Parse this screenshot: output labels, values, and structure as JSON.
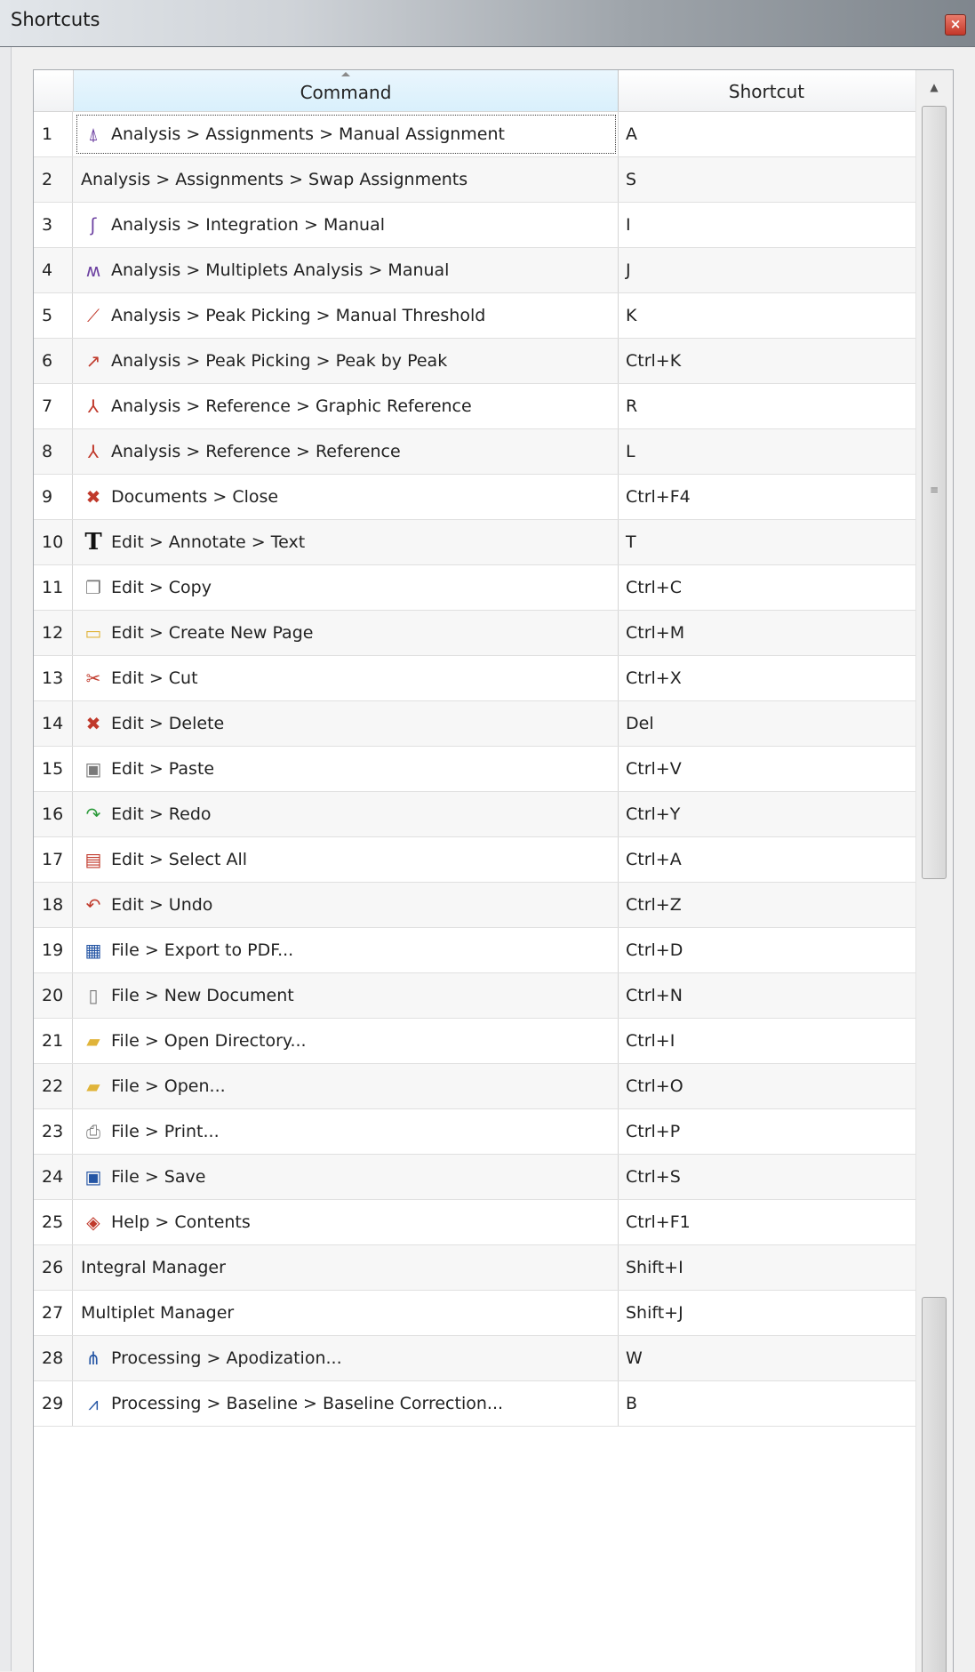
{
  "window": {
    "title": "Shortcuts",
    "close_icon": "close-icon"
  },
  "table": {
    "headers": {
      "command": "Command",
      "shortcut": "Shortcut"
    },
    "rows": [
      {
        "num": "1",
        "command": "Analysis > Assignments > Manual Assignment",
        "shortcut": "A",
        "icon": "manual-assignment-icon",
        "glyph": "⍋"
      },
      {
        "num": "2",
        "command": "Analysis > Assignments > Swap Assignments",
        "shortcut": "S",
        "icon": "",
        "glyph": ""
      },
      {
        "num": "3",
        "command": "Analysis > Integration > Manual",
        "shortcut": "I",
        "icon": "integration-icon",
        "glyph": "ʃ"
      },
      {
        "num": "4",
        "command": "Analysis > Multiplets Analysis > Manual",
        "shortcut": "J",
        "icon": "multiplets-icon",
        "glyph": "ʍ"
      },
      {
        "num": "5",
        "command": "Analysis > Peak Picking > Manual Threshold",
        "shortcut": "K",
        "icon": "peak-threshold-icon",
        "glyph": "⟋"
      },
      {
        "num": "6",
        "command": "Analysis > Peak Picking > Peak by Peak",
        "shortcut": "Ctrl+K",
        "icon": "peak-by-peak-icon",
        "glyph": "↗"
      },
      {
        "num": "7",
        "command": "Analysis > Reference > Graphic Reference",
        "shortcut": "R",
        "icon": "graphic-reference-icon",
        "glyph": "⅄"
      },
      {
        "num": "8",
        "command": "Analysis > Reference > Reference",
        "shortcut": "L",
        "icon": "reference-icon",
        "glyph": "⅄"
      },
      {
        "num": "9",
        "command": "Documents > Close",
        "shortcut": "Ctrl+F4",
        "icon": "document-close-icon",
        "glyph": "✖"
      },
      {
        "num": "10",
        "command": "Edit > Annotate > Text",
        "shortcut": "T",
        "icon": "text-icon",
        "glyph": "T"
      },
      {
        "num": "11",
        "command": "Edit > Copy",
        "shortcut": "Ctrl+C",
        "icon": "copy-icon",
        "glyph": "❐"
      },
      {
        "num": "12",
        "command": "Edit > Create New Page",
        "shortcut": "Ctrl+M",
        "icon": "new-page-icon",
        "glyph": "▭"
      },
      {
        "num": "13",
        "command": "Edit > Cut",
        "shortcut": "Ctrl+X",
        "icon": "cut-icon",
        "glyph": "✂"
      },
      {
        "num": "14",
        "command": "Edit > Delete",
        "shortcut": "Del",
        "icon": "delete-icon",
        "glyph": "✖"
      },
      {
        "num": "15",
        "command": "Edit > Paste",
        "shortcut": "Ctrl+V",
        "icon": "paste-icon",
        "glyph": "▣"
      },
      {
        "num": "16",
        "command": "Edit > Redo",
        "shortcut": "Ctrl+Y",
        "icon": "redo-icon",
        "glyph": "↷"
      },
      {
        "num": "17",
        "command": "Edit > Select All",
        "shortcut": "Ctrl+A",
        "icon": "select-all-icon",
        "glyph": "▤"
      },
      {
        "num": "18",
        "command": "Edit > Undo",
        "shortcut": "Ctrl+Z",
        "icon": "undo-icon",
        "glyph": "↶"
      },
      {
        "num": "19",
        "command": "File > Export to PDF...",
        "shortcut": "Ctrl+D",
        "icon": "export-pdf-icon",
        "glyph": "▦"
      },
      {
        "num": "20",
        "command": "File > New Document",
        "shortcut": "Ctrl+N",
        "icon": "new-document-icon",
        "glyph": "▯"
      },
      {
        "num": "21",
        "command": "File > Open Directory...",
        "shortcut": "Ctrl+I",
        "icon": "open-directory-icon",
        "glyph": "▰"
      },
      {
        "num": "22",
        "command": "File > Open...",
        "shortcut": "Ctrl+O",
        "icon": "open-folder-icon",
        "glyph": "▰"
      },
      {
        "num": "23",
        "command": "File > Print...",
        "shortcut": "Ctrl+P",
        "icon": "print-icon",
        "glyph": "⎙"
      },
      {
        "num": "24",
        "command": "File > Save",
        "shortcut": "Ctrl+S",
        "icon": "save-icon",
        "glyph": "▣"
      },
      {
        "num": "25",
        "command": "Help > Contents",
        "shortcut": "Ctrl+F1",
        "icon": "help-icon",
        "glyph": "◈"
      },
      {
        "num": "26",
        "command": "Integral Manager",
        "shortcut": "Shift+I",
        "icon": "",
        "glyph": ""
      },
      {
        "num": "27",
        "command": "Multiplet Manager",
        "shortcut": "Shift+J",
        "icon": "",
        "glyph": ""
      },
      {
        "num": "28",
        "command": "Processing > Apodization...",
        "shortcut": "W",
        "icon": "apodization-icon",
        "glyph": "⋔"
      },
      {
        "num": "29",
        "command": "Processing > Baseline > Baseline Correction...",
        "shortcut": "B",
        "icon": "baseline-correction-icon",
        "glyph": "⩘"
      }
    ]
  },
  "colors": {
    "header_active": "#d9f0fc",
    "grid": "#d5d5d5",
    "row_alt": "#f7f7f7"
  }
}
